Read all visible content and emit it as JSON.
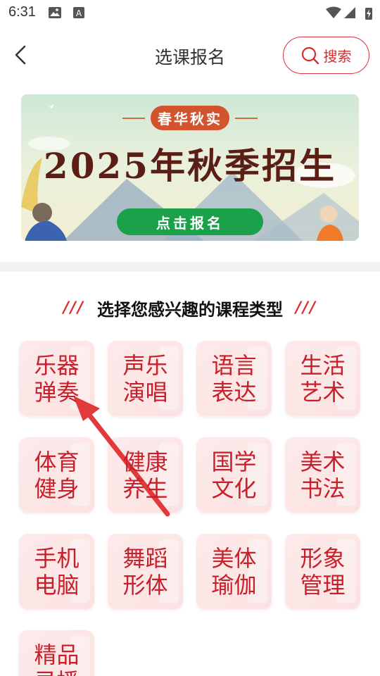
{
  "status_bar": {
    "time": "6:31"
  },
  "header": {
    "title": "选课报名",
    "search_label": "搜索"
  },
  "banner": {
    "tag": "春华秋实",
    "headline": "2025年秋季招生",
    "cta": "点击报名"
  },
  "section": {
    "decor_left": "///",
    "title": "选择您感兴趣的课程类型",
    "decor_right": "///"
  },
  "categories": [
    {
      "label": "乐器弹奏"
    },
    {
      "label": "声乐演唱"
    },
    {
      "label": "语言表达"
    },
    {
      "label": "生活艺术"
    },
    {
      "label": "体育健身"
    },
    {
      "label": "健康养生"
    },
    {
      "label": "国学文化"
    },
    {
      "label": "美术书法"
    },
    {
      "label": "手机电脑"
    },
    {
      "label": "舞蹈形体"
    },
    {
      "label": "美体瑜伽"
    },
    {
      "label": "形象管理"
    },
    {
      "label": "精品录播"
    }
  ],
  "colors": {
    "accent": "#d32f2f",
    "cta_green": "#1aa14a",
    "tile_bg": "#fdeaea"
  }
}
